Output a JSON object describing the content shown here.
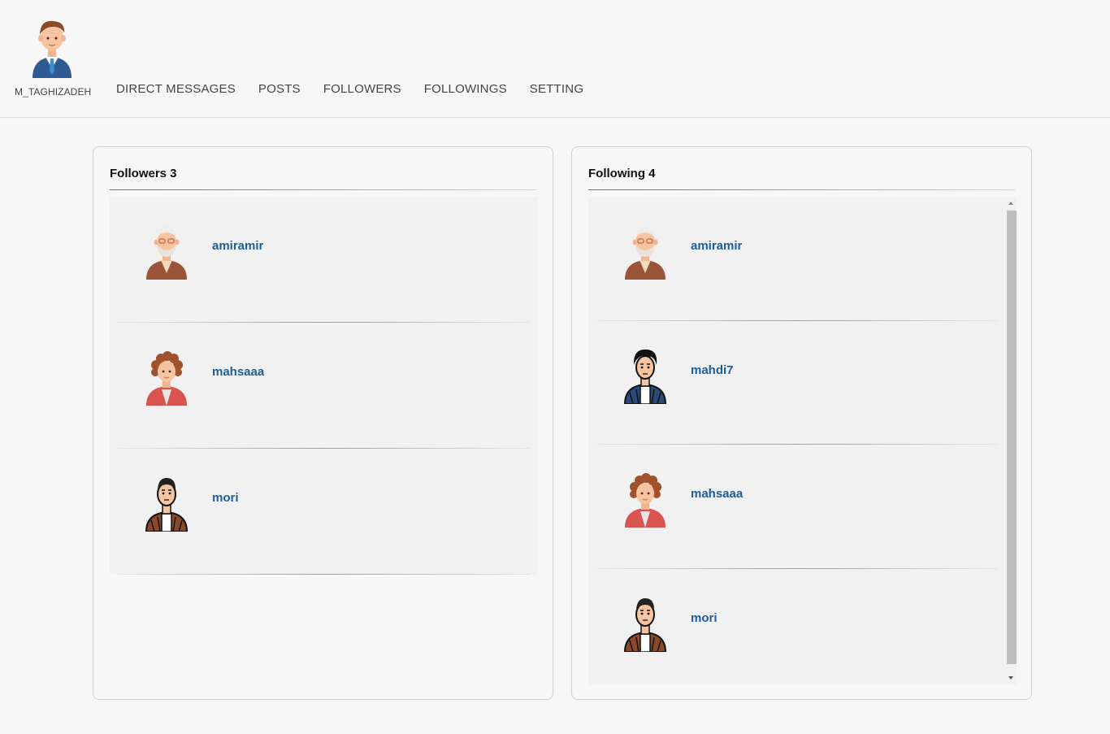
{
  "profile": {
    "username": "M_TAGHIZADEH",
    "avatar_icon": "businessman-avatar-icon"
  },
  "nav": [
    {
      "label": "DIRECT MESSAGES",
      "name": "nav-direct-messages"
    },
    {
      "label": "POSTS",
      "name": "nav-posts"
    },
    {
      "label": "FOLLOWERS",
      "name": "nav-followers"
    },
    {
      "label": "FOLLOWINGS",
      "name": "nav-followings"
    },
    {
      "label": "SETTING",
      "name": "nav-setting"
    }
  ],
  "followers": {
    "title": "Followers 3",
    "items": [
      {
        "username": "amiramir",
        "avatar": "old-man"
      },
      {
        "username": "mahsaaa",
        "avatar": "curly-hair"
      },
      {
        "username": "mori",
        "avatar": "young-man"
      }
    ]
  },
  "following": {
    "title": "Following 4",
    "items": [
      {
        "username": "amiramir",
        "avatar": "old-man"
      },
      {
        "username": "mahdi7",
        "avatar": "dark-man"
      },
      {
        "username": "mahsaaa",
        "avatar": "curly-hair"
      },
      {
        "username": "mori",
        "avatar": "young-man"
      }
    ]
  },
  "colors": {
    "link": "#1e5c99",
    "background": "#f7f7f7",
    "list_bg": "#f1f1f1"
  }
}
